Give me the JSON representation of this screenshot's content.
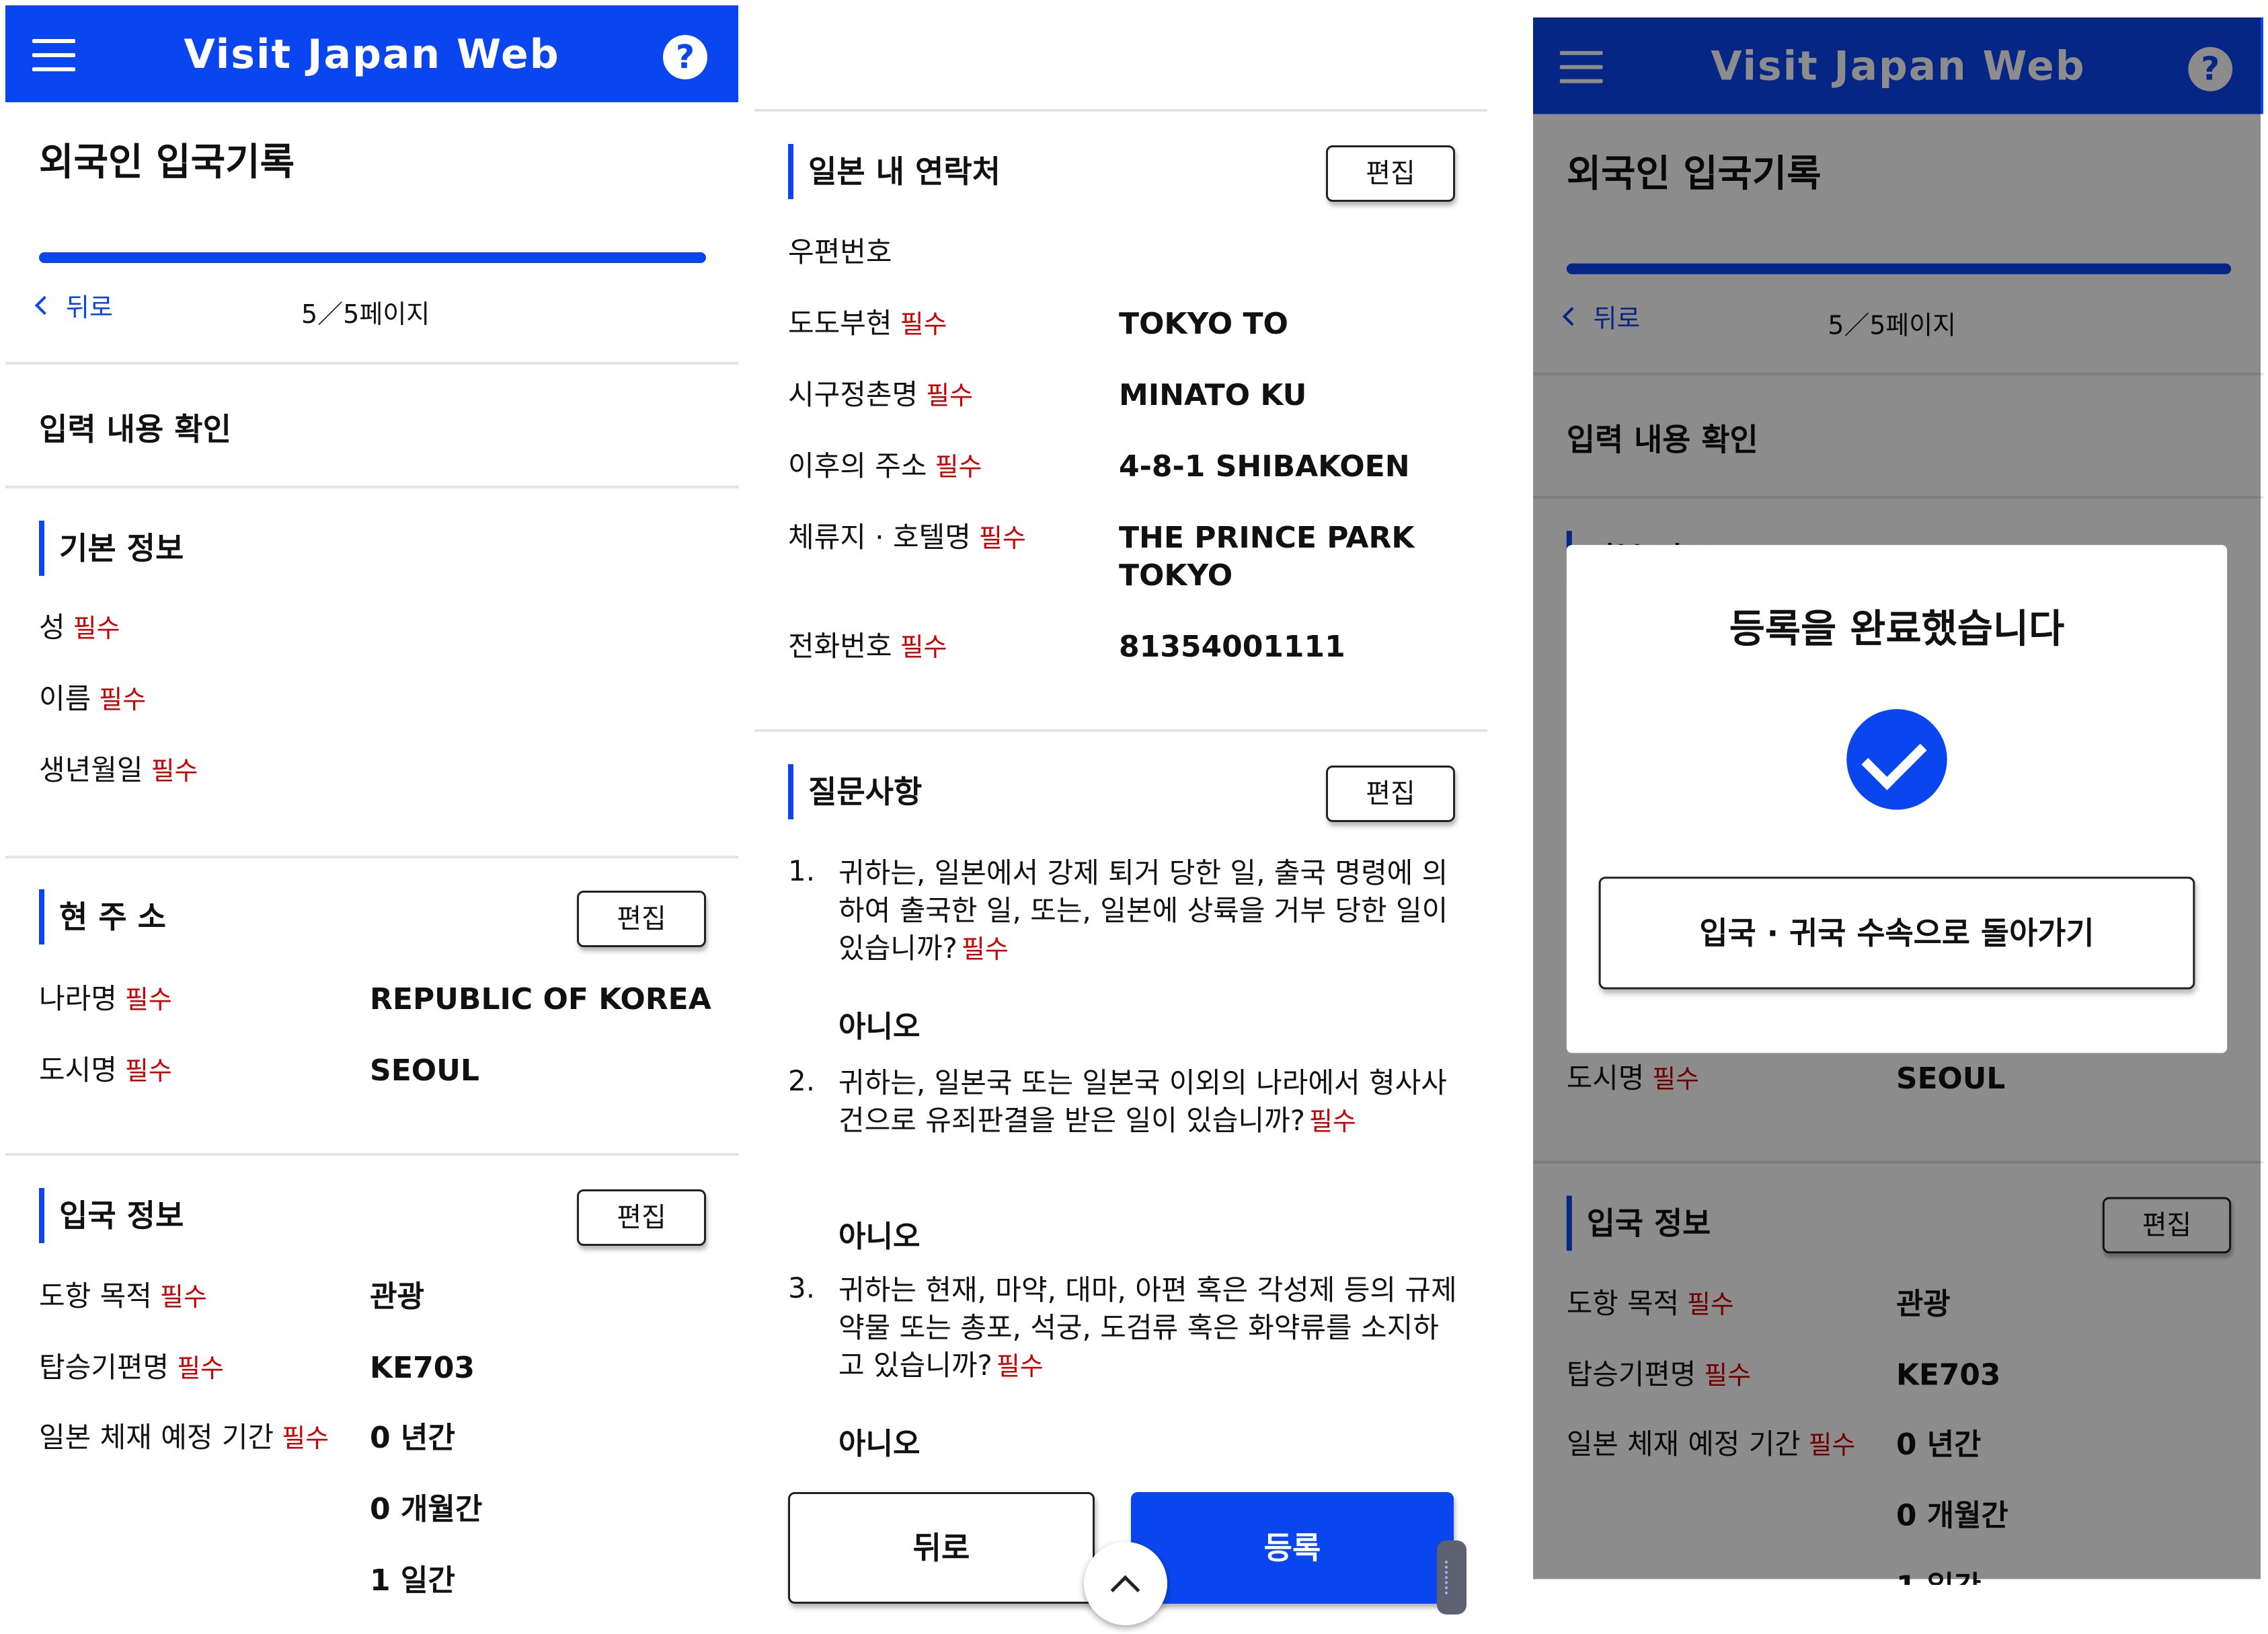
{
  "header": {
    "title": "Visit Japan Web",
    "help_icon": "?"
  },
  "page": {
    "title": "외국인 입국기록",
    "progress": 1.0,
    "back_link": "뒤로",
    "page_indicator": "5／5페이지",
    "subtitle": "입력 내용 확인"
  },
  "required_tag": "필수",
  "edit_label": "편집",
  "basic_info": {
    "heading": "기본 정보",
    "fields": [
      {
        "label": "성"
      },
      {
        "label": "이름"
      },
      {
        "label": "생년월일"
      }
    ]
  },
  "current_address": {
    "heading": "현 주 소",
    "fields": [
      {
        "label": "나라명",
        "value": "REPUBLIC OF KOREA"
      },
      {
        "label": "도시명",
        "value": "SEOUL"
      }
    ]
  },
  "entry_info": {
    "heading": "입국 정보",
    "fields": [
      {
        "label": "도항 목적",
        "value": "관광"
      },
      {
        "label": "탑승기편명",
        "value": "KE703"
      },
      {
        "label": "일본 체재 예정 기간",
        "values": [
          "0 년간",
          "0 개월간",
          "1 일간"
        ]
      }
    ]
  },
  "japan_contact": {
    "heading": "일본 내 연락처",
    "fields": [
      {
        "label": "우편번호",
        "required": false,
        "value": ""
      },
      {
        "label": "도도부현",
        "required": true,
        "value": "TOKYO TO"
      },
      {
        "label": "시구정촌명",
        "required": true,
        "value": "MINATO KU"
      },
      {
        "label": "이후의 주소",
        "required": true,
        "value": "4-8-1 SHIBAKOEN"
      },
      {
        "label": "체류지 · 호텔명",
        "required": true,
        "value": "THE PRINCE PARK TOKYO"
      },
      {
        "label": "전화번호",
        "required": true,
        "value": "81354001111"
      }
    ]
  },
  "questions": {
    "heading": "질문사항",
    "items": [
      {
        "num": "1.",
        "text": "귀하는, 일본에서 강제 퇴거 당한 일, 출국 명령에 의하여 출국한 일, 또는, 일본에 상륙을 거부 당한 일이 있습니까?",
        "answer": "아니오"
      },
      {
        "num": "2.",
        "text": "귀하는, 일본국 또는 일본국 이외의 나라에서 형사사건으로 유죄판결을 받은 일이 있습니까?",
        "answer": "아니오"
      },
      {
        "num": "3.",
        "text": "귀하는 현재, 마약, 대마, 아편 혹은 각성제 등의 규제약물 또는 총포, 석궁, 도검류 혹은 화약류를 소지하고 있습니까?",
        "answer": "아니오"
      }
    ]
  },
  "footer": {
    "back_label": "뒤로",
    "register_label": "등록"
  },
  "modal": {
    "title": "등록을 완료했습니다",
    "return_button": "입국 · 귀국 수속으로 돌아가기"
  },
  "colors": {
    "brand_blue": "#0a46f0",
    "required_red": "#cc0000"
  }
}
